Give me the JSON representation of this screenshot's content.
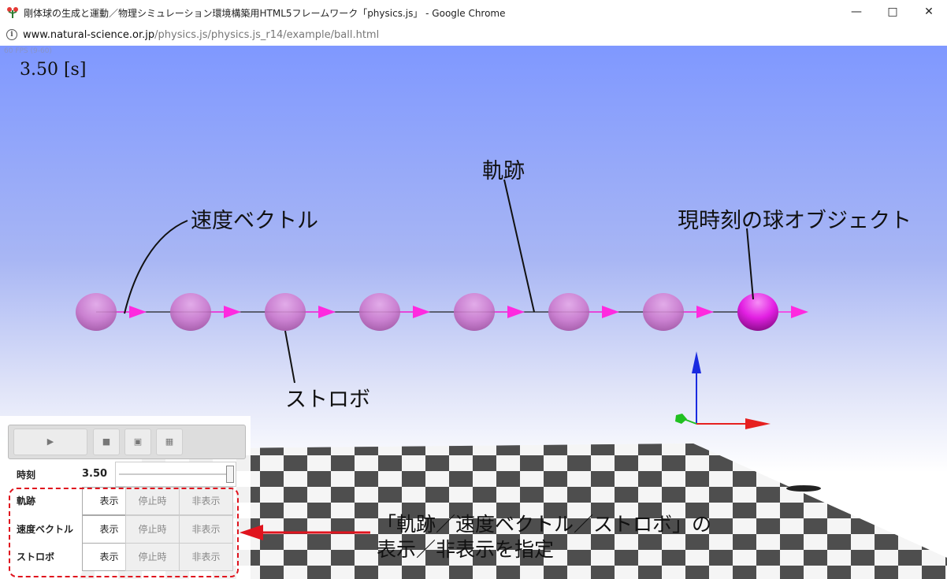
{
  "window": {
    "title": "剛体球の生成と運動／物理シミュレーション環境構築用HTML5フレームワーク「physics.js」 - Google Chrome",
    "minimize_icon": "minimize-icon",
    "maximize_icon": "maximize-icon",
    "close_icon": "close-icon"
  },
  "address": {
    "host": "www.natural-science.or.jp",
    "path": "/physics.js/physics.js_r14/example/ball.html",
    "icon": "info-icon"
  },
  "scene": {
    "fps": "60 FPS (9-60)",
    "time_display": "3.50 [s]",
    "ball_count": 8,
    "ball_color": "#cc77cc",
    "current_ball_color": "#e21fe2",
    "vector_color": "#ff2adf",
    "labels": {
      "trajectory": "軌跡",
      "velocity_vector": "速度ベクトル",
      "current_ball": "現時刻の球オブジェクト",
      "strobe": "ストロボ"
    },
    "axes": {
      "x_color": "#e62020",
      "y_color": "#20c020",
      "z_color": "#1a2be0"
    }
  },
  "controls": {
    "play_icon": "play-icon",
    "stop_icon": "stop-icon",
    "image_icon": "image-icon",
    "grid_icon": "grid-icon",
    "time_label": "時刻",
    "time_value": "3.50",
    "slider_fraction": 1.0,
    "rows": [
      {
        "label": "軌跡",
        "options": [
          "表示",
          "停止時",
          "非表示"
        ],
        "selected": "表示"
      },
      {
        "label": "速度ベクトル",
        "options": [
          "表示",
          "停止時",
          "非表示"
        ],
        "selected": "表示"
      },
      {
        "label": "ストロボ",
        "options": [
          "表示",
          "停止時",
          "非表示"
        ],
        "selected": "表示"
      }
    ]
  },
  "annotation": {
    "line1": "「軌跡／速度ベクトル／ストロボ」の",
    "line2": "表示／非表示を指定",
    "color": "#e0141e"
  }
}
